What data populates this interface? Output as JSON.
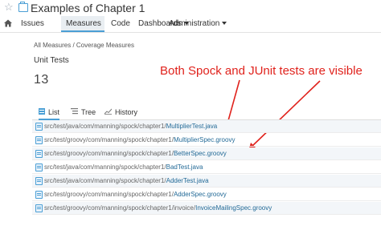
{
  "header": {
    "project_title": "Examples of Chapter 1",
    "star_icon": "star-outline-icon",
    "project_icon": "briefcase-icon"
  },
  "nav": {
    "home_icon": "home-icon",
    "items": [
      {
        "label": "Issues"
      },
      {
        "label": "Measures"
      },
      {
        "label": "Code"
      },
      {
        "label": "Dashboards"
      },
      {
        "label": "Administration"
      }
    ],
    "active": "Measures"
  },
  "breadcrumb": "All Measures / Coverage Measures",
  "metric": {
    "name": "Unit Tests",
    "value": "13"
  },
  "annotation": {
    "text": "Both Spock and JUnit tests are visible",
    "color": "#e0221c"
  },
  "view_tabs": [
    {
      "label": "List",
      "icon": "list-icon"
    },
    {
      "label": "Tree",
      "icon": "tree-icon"
    },
    {
      "label": "History",
      "icon": "history-chart-icon"
    }
  ],
  "files": [
    {
      "dir": "src/test/java/com/manning/spock/chapter1/",
      "name": "MultiplierTest.java"
    },
    {
      "dir": "src/test/groovy/com/manning/spock/chapter1/",
      "name": "MultiplierSpec.groovy"
    },
    {
      "dir": "src/test/groovy/com/manning/spock/chapter1/",
      "name": "BetterSpec.groovy"
    },
    {
      "dir": "src/test/java/com/manning/spock/chapter1/",
      "name": "BadTest.java"
    },
    {
      "dir": "src/test/java/com/manning/spock/chapter1/",
      "name": "AdderTest.java"
    },
    {
      "dir": "src/test/groovy/com/manning/spock/chapter1/",
      "name": "AdderSpec.groovy"
    },
    {
      "dir": "src/test/groovy/com/manning/spock/chapter1/invoice/",
      "name": "InvoiceMailingSpec.groovy"
    }
  ]
}
